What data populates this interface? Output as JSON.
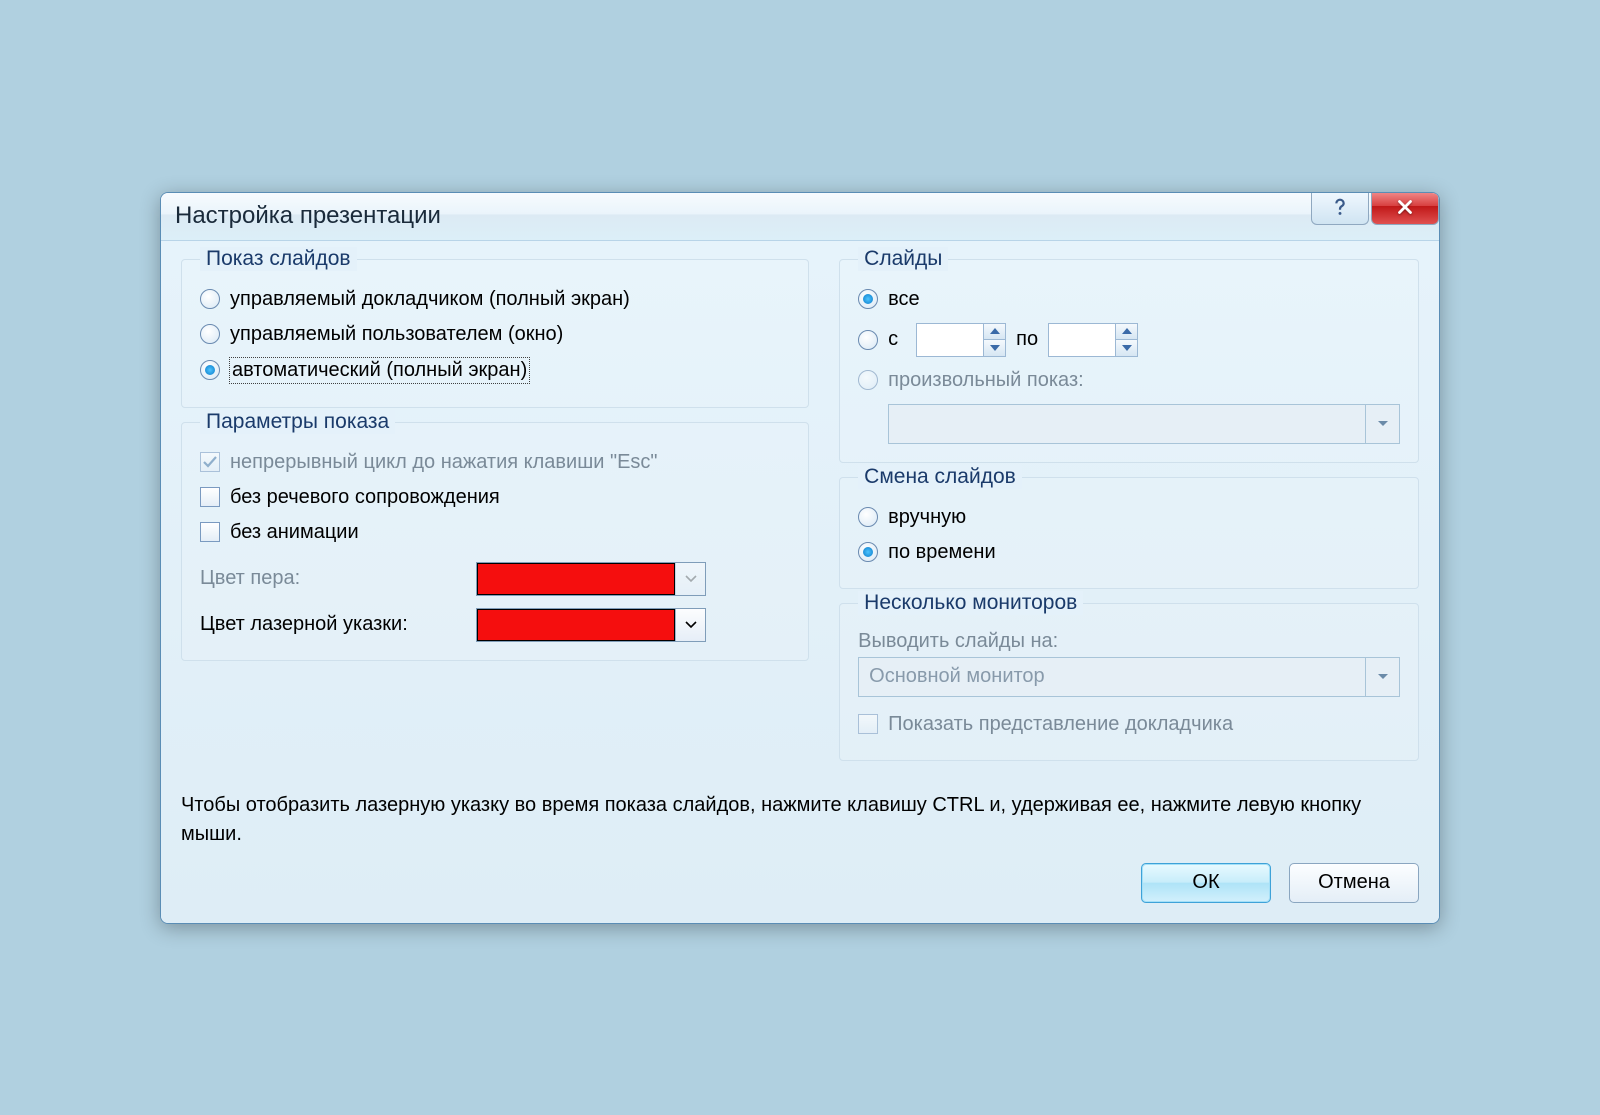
{
  "title": "Настройка презентации",
  "showType": {
    "legend": "Показ слайдов",
    "presenter": "управляемый докладчиком (полный экран)",
    "browser": "управляемый пользователем (окно)",
    "kiosk": "автоматический (полный экран)"
  },
  "options": {
    "legend": "Параметры показа",
    "loop": "непрерывный цикл до нажатия клавиши \"Esc\"",
    "noNarration": "без речевого сопровождения",
    "noAnimation": "без анимации",
    "penColorLabel": "Цвет пера:",
    "laserColorLabel": "Цвет лазерной указки:",
    "penColor": "#f50e0e",
    "laserColor": "#f50e0e"
  },
  "slides": {
    "legend": "Слайды",
    "all": "все",
    "fromLabel": "с",
    "toLabel": "по",
    "customShow": "произвольный показ:"
  },
  "advance": {
    "legend": "Смена слайдов",
    "manual": "вручную",
    "timings": "по времени"
  },
  "monitors": {
    "legend": "Несколько мониторов",
    "displayOn": "Выводить слайды на:",
    "selected": "Основной монитор",
    "presenterView": "Показать представление докладчика"
  },
  "hint": "Чтобы отобразить лазерную указку во время показа слайдов, нажмите клавишу CTRL и, удерживая ее, нажмите левую кнопку мыши.",
  "buttons": {
    "ok": "ОК",
    "cancel": "Отмена"
  }
}
